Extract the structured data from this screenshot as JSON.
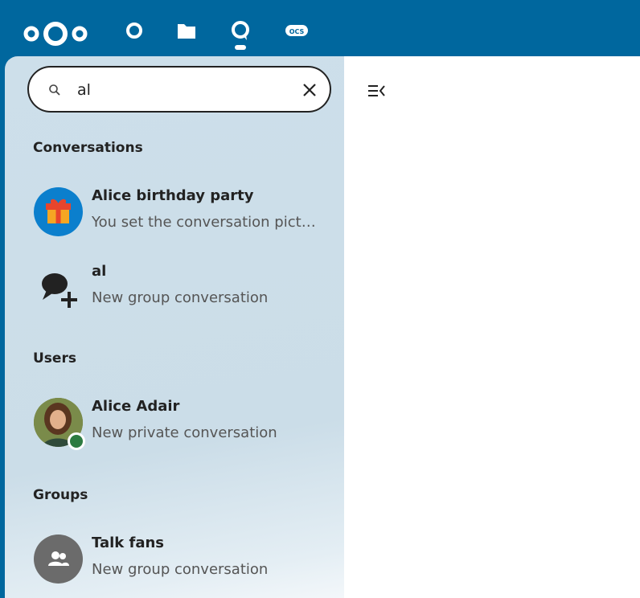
{
  "header": {
    "apps": [
      {
        "name": "dashboard",
        "icon": "dashboard-icon"
      },
      {
        "name": "files",
        "icon": "folder-icon"
      },
      {
        "name": "talk",
        "icon": "talk-icon"
      },
      {
        "name": "ocs",
        "icon": "ocs-icon",
        "label": "OCS"
      }
    ]
  },
  "search": {
    "value": "al"
  },
  "sections": {
    "conversations": "Conversations",
    "users": "Users",
    "groups": "Groups"
  },
  "conversations": [
    {
      "name": "Alice birthday party",
      "sub": "You set the conversation picture",
      "icon": "gift-icon"
    },
    {
      "name": "al",
      "sub": "New group conversation",
      "icon": "new-conversation-icon"
    }
  ],
  "users": [
    {
      "name": "Alice Adair",
      "sub": "New private conversation",
      "status": "online"
    }
  ],
  "groups": [
    {
      "name": "Talk fans",
      "sub": "New group conversation",
      "icon": "group-icon"
    }
  ],
  "colors": {
    "brand": "#00679e",
    "online": "#2d7b41",
    "sidebar": "#cddfea"
  }
}
